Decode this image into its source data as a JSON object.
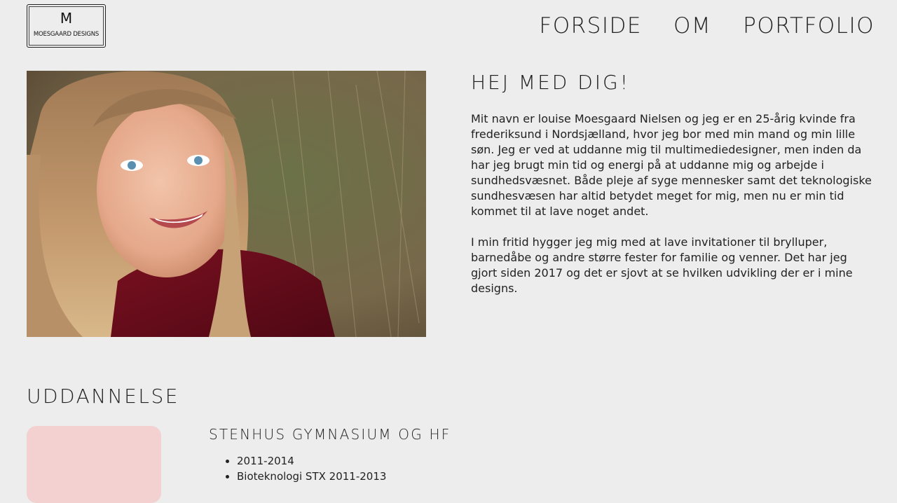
{
  "header": {
    "logo": {
      "mark": "M",
      "text": "MOESGAARD DESIGNS"
    },
    "nav": [
      "FORSIDE",
      "OM",
      "PORTFOLIO"
    ]
  },
  "intro": {
    "heading": "HEJ MED DIG!",
    "paragraphs": [
      "Mit navn er louise Moesgaard Nielsen og jeg er en 25-årig kvinde fra frederiksund i Nordsjælland, hvor jeg bor med min mand og min lille søn. Jeg er ved at uddanne mig til multimediedesigner, men inden da har jeg brugt min tid og energi på at uddanne mig og arbejde i sundhedsvæsnet. Både pleje af syge mennesker samt det teknologiske sundhesvæsen har altid betydet meget for mig, men nu er min tid kommet til at lave noget andet.",
      "I min fritid hygger jeg mig med at lave invitationer til brylluper, barnedåbe og andre større fester for familie og venner. Det har jeg gjort siden 2017 og det er sjovt at se hvilken udvikling der er i mine designs."
    ]
  },
  "education": {
    "title": "UDDANNELSE",
    "items": [
      {
        "school": "STENHUS GYMNASIUM OG HF",
        "details": [
          "2011-2014",
          "Bioteknologi STX 2011-2013"
        ]
      }
    ]
  },
  "colors": {
    "background": "#ededed",
    "thumb": "#f3d1d1",
    "text": "#222222"
  }
}
